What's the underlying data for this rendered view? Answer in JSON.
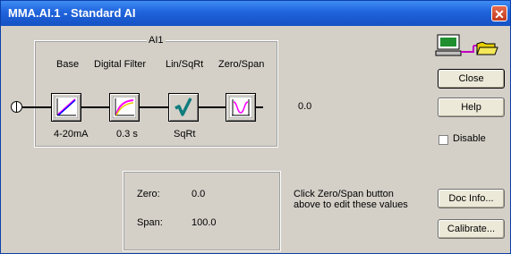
{
  "window": {
    "title": "MMA.AI.1 - Standard AI"
  },
  "block": {
    "name": "AI1",
    "functions": [
      {
        "header": "Base",
        "value": "4-20mA",
        "icon": "ramp-graph-icon"
      },
      {
        "header": "Digital Filter",
        "value": "0.3 s",
        "icon": "filter-curve-icon"
      },
      {
        "header": "Lin/SqRt",
        "value": "SqRt",
        "icon": "sqrt-icon"
      },
      {
        "header": "Zero/Span",
        "value": "",
        "icon": "zero-span-icon"
      }
    ],
    "output_value": "0.0"
  },
  "zero_span": {
    "zero_label": "Zero:",
    "zero_value": "0.0",
    "span_label": "Span:",
    "span_value": "100.0"
  },
  "hint": {
    "line1": "Click Zero/Span button",
    "line2": "above to edit these values"
  },
  "buttons": {
    "close": "Close",
    "help": "Help",
    "doc_info": "Doc Info...",
    "calibrate": "Calibrate..."
  },
  "disable": {
    "label": "Disable",
    "checked": false
  },
  "colors": {
    "titlebar": "#1f63dc",
    "dialog": "#d4d0c8",
    "close_button": "#d4512f"
  }
}
